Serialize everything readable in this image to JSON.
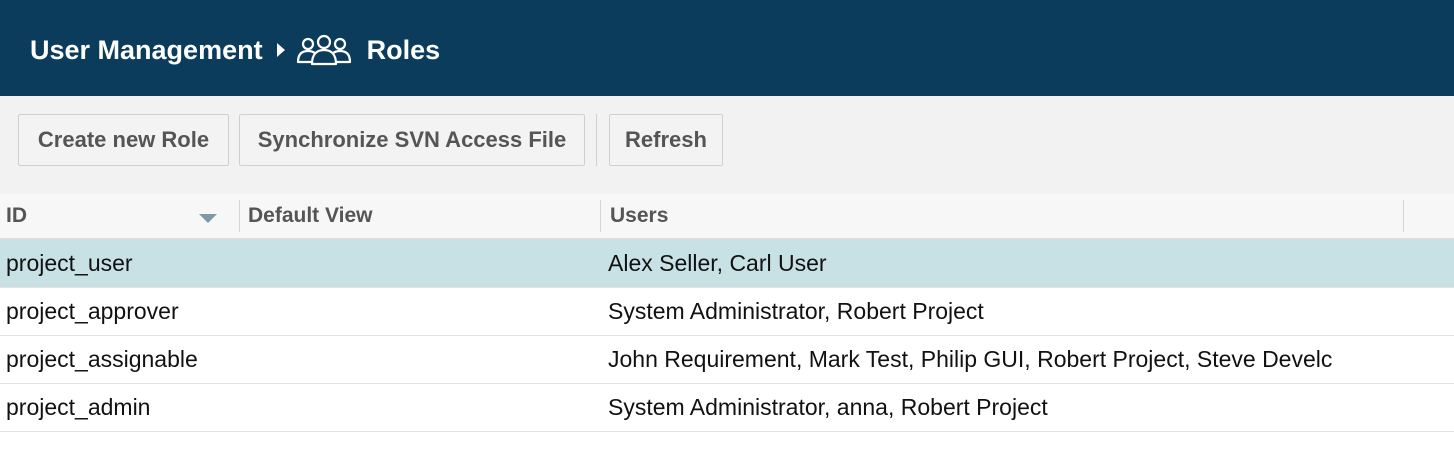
{
  "header": {
    "breadcrumb_root": "User Management",
    "icon": "users-group-icon",
    "page_title": "Roles",
    "background": "#0c3c5c"
  },
  "toolbar": {
    "create_label": "Create new Role",
    "sync_label": "Synchronize SVN Access File",
    "refresh_label": "Refresh"
  },
  "table": {
    "columns": [
      "ID",
      "Default View",
      "Users"
    ],
    "sort_column": "ID",
    "rows": [
      {
        "id": "project_user",
        "default_view": "",
        "users": "Alex Seller, Carl User",
        "selected": true
      },
      {
        "id": "project_approver",
        "default_view": "",
        "users": "System Administrator, Robert Project",
        "selected": false
      },
      {
        "id": "project_assignable",
        "default_view": "",
        "users": "John Requirement, Mark Test, Philip GUI, Robert Project, Steve Develc",
        "selected": false
      },
      {
        "id": "project_admin",
        "default_view": "",
        "users": "System Administrator, anna, Robert Project",
        "selected": false
      }
    ],
    "selected_row_color": "#c7e1e5"
  }
}
